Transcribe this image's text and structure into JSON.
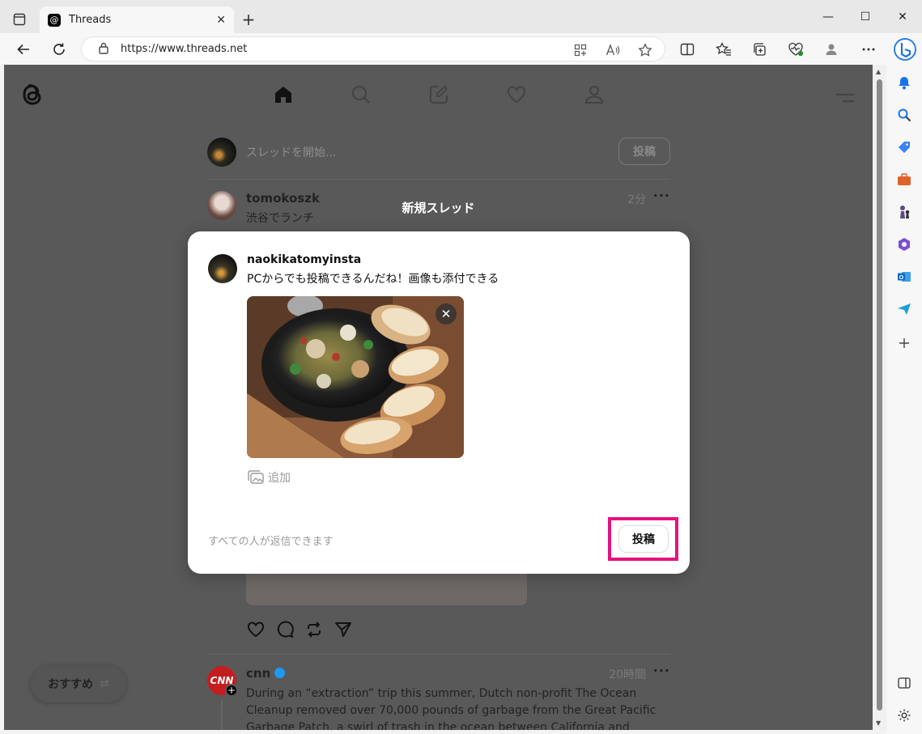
{
  "browser": {
    "tab_title": "Threads",
    "url": "https://www.threads.net",
    "new_tab_symbol": "+",
    "tab_close_symbol": "✕",
    "minimize_symbol": "—",
    "maximize_symbol": "☐",
    "close_symbol": "✕"
  },
  "composer": {
    "placeholder": "スレッドを開始...",
    "post_label": "投稿"
  },
  "feed": {
    "post1": {
      "user": "tomokoszk",
      "time": "2分",
      "text": "渋谷でランチ",
      "more": "···"
    },
    "post2": {
      "user": "cnn",
      "time": "20時間",
      "more": "···",
      "logo_text": "CNN",
      "text": "During an “extraction” trip this summer, Dutch non-profit The Ocean Cleanup removed over 70,000 pounds of garbage from the Great Pacific Garbage Patch, a swirl of trash in the ocean between California and Hawaii. Most of the trash is"
    }
  },
  "recommend": {
    "label": "おすすめ",
    "switch_symbol": "⇄"
  },
  "modal": {
    "title": "新規スレッド",
    "user": "naokikatomyinsta",
    "text": "PCからでも投稿できるんだね！画像も添付できる",
    "add_label": "追加",
    "reply_setting": "すべての人が返信できます",
    "post_label": "投稿",
    "image_close_symbol": "✕"
  },
  "colors": {
    "highlight": "#e6127f",
    "overlay": "#595959",
    "edge_blue": "#1a73e8"
  }
}
